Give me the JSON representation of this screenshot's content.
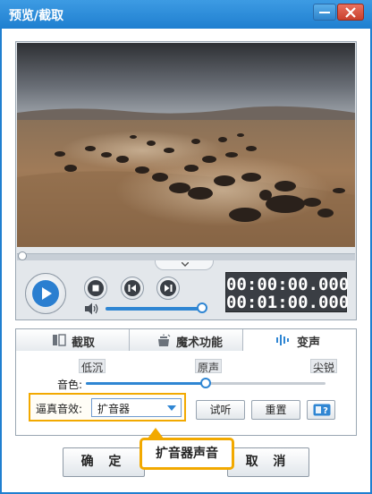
{
  "window": {
    "title": "预览/截取",
    "minimize_glyph": "minus-icon",
    "close_glyph": "close-icon"
  },
  "player": {
    "current_time": "00:00:00.000",
    "total_time": "00:01:00.000",
    "progress": 0.0,
    "volume": 1.0
  },
  "tabs": [
    {
      "label": "截取",
      "icon": "crop-icon",
      "selected": false
    },
    {
      "label": "魔术功能",
      "icon": "magic-icon",
      "selected": false
    },
    {
      "label": "变声",
      "icon": "waveform-icon",
      "selected": true
    }
  ],
  "voice": {
    "pitch_low": "低沉",
    "pitch_mid": "原声",
    "pitch_high": "尖锐",
    "timbre_label": "音色:",
    "pitch_value": 0.5,
    "effect_label": "逼真音效:",
    "effect_value": "扩音器",
    "listen_button": "试听",
    "reset_button": "重置"
  },
  "footer": {
    "ok_button": "确 定",
    "cancel_button": "取 消",
    "tooltip": "扩音器声音"
  },
  "colors": {
    "title_bar": "#1f7fd0",
    "accent": "#2f86d3",
    "highlight": "#f2a900",
    "timecode_bg": "#3a3e44"
  }
}
